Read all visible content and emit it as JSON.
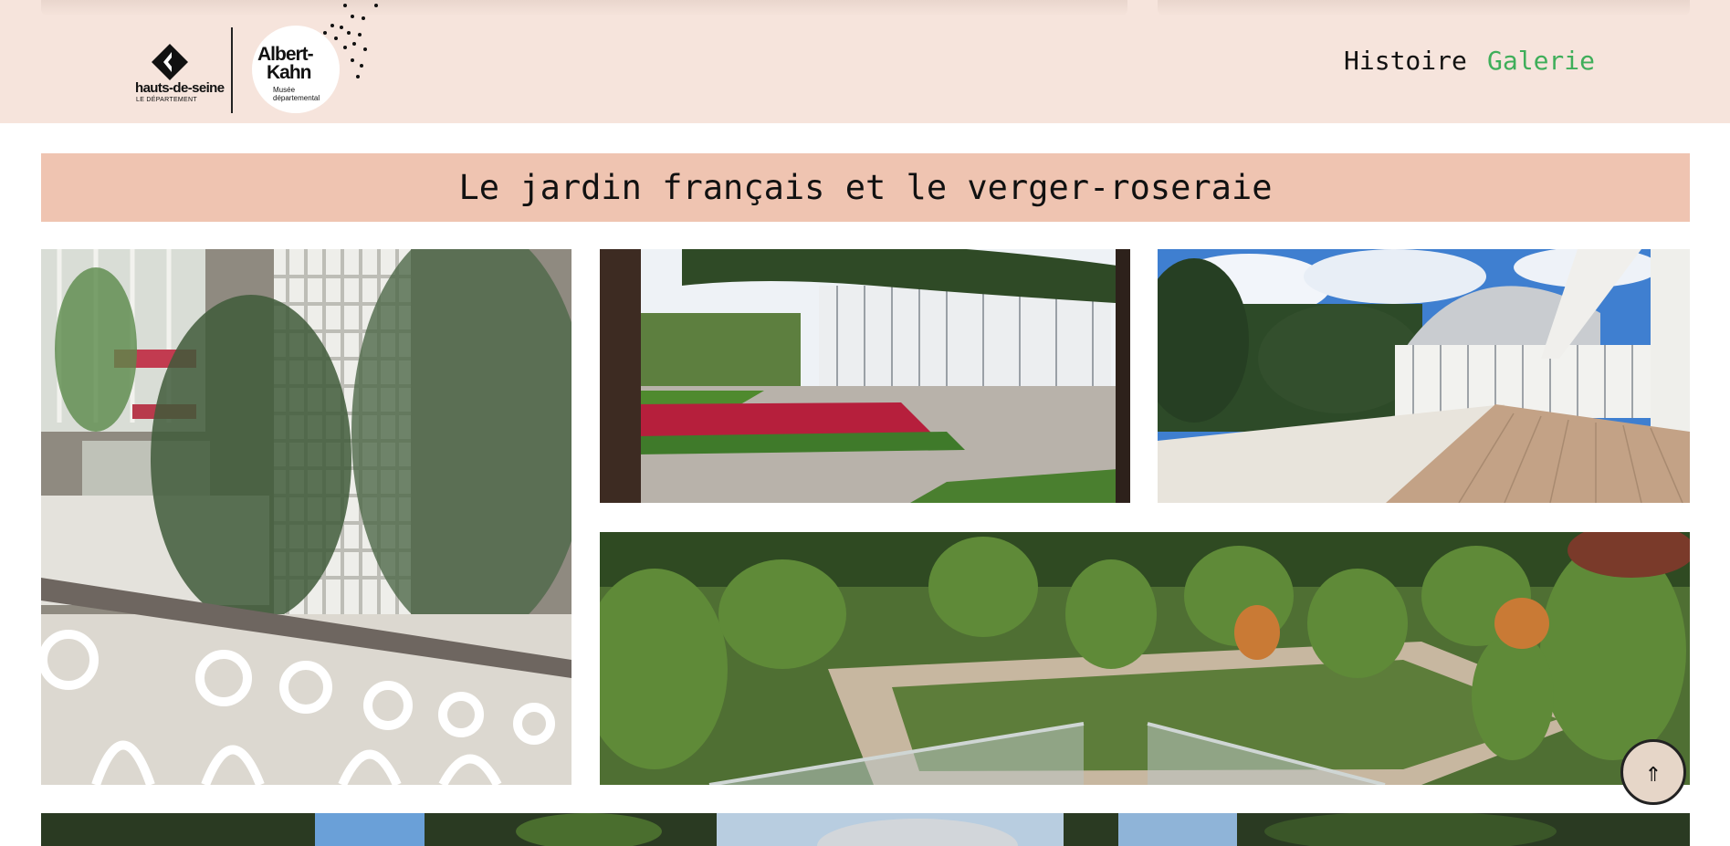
{
  "brand": {
    "department_name": "hauts-de-seine",
    "department_sub": "LE DÉPARTEMENT",
    "museum_name_line1": "Albert-",
    "museum_name_line2": "Kahn",
    "museum_sub_line1": "Musée",
    "museum_sub_line2": "départemental"
  },
  "nav": {
    "items": [
      {
        "label": "Histoire",
        "active": false
      },
      {
        "label": "Galerie",
        "active": true
      }
    ],
    "active_color": "#3fae5a"
  },
  "gallery": {
    "title": "Le jardin français et le verger-roseraie",
    "photos": [
      {
        "subject": "greenhouse interior with white lattice and railing"
      },
      {
        "subject": "french garden with red flower beds and greenhouse"
      },
      {
        "subject": "greenhouse dome and wooden terrace under blue sky"
      },
      {
        "subject": "orchard-rose garden seen from above"
      },
      {
        "subject": "trees and greenhouse dome"
      }
    ]
  },
  "scroll_top": {
    "icon": "up-arrow-icon",
    "glyph": "⇑"
  },
  "colors": {
    "header_bg": "#f6e4dc",
    "title_bar_bg": "#efc4b1"
  }
}
